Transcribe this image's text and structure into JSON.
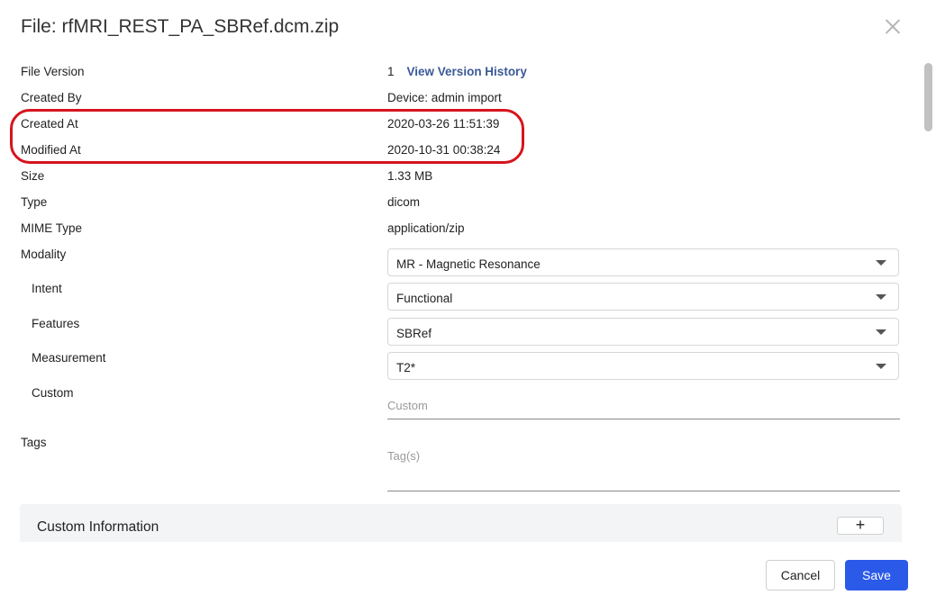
{
  "header": {
    "title": "File: rfMRI_REST_PA_SBRef.dcm.zip",
    "close_icon": "close-icon"
  },
  "fields": {
    "file_version": {
      "label": "File Version",
      "value": "1",
      "link": "View Version History"
    },
    "created_by": {
      "label": "Created By",
      "value": "Device: admin import"
    },
    "created_at": {
      "label": "Created At",
      "value": "2020-03-26 11:51:39"
    },
    "modified_at": {
      "label": "Modified At",
      "value": "2020-10-31 00:38:24"
    },
    "size": {
      "label": "Size",
      "value": "1.33 MB"
    },
    "type": {
      "label": "Type",
      "value": "dicom"
    },
    "mime_type": {
      "label": "MIME Type",
      "value": "application/zip"
    },
    "modality": {
      "label": "Modality",
      "value": "MR - Magnetic Resonance"
    },
    "intent": {
      "label": "Intent",
      "value": "Functional"
    },
    "features": {
      "label": "Features",
      "value": "SBRef"
    },
    "measurement": {
      "label": "Measurement",
      "value": "T2*"
    },
    "custom": {
      "label": "Custom",
      "placeholder": "Custom"
    },
    "tags": {
      "label": "Tags",
      "placeholder": "Tag(s)"
    }
  },
  "custom_information": {
    "title": "Custom Information",
    "add_label": "+"
  },
  "footer": {
    "cancel_label": "Cancel",
    "save_label": "Save"
  },
  "colors": {
    "accent": "#2b5ae8",
    "link": "#3b5998",
    "highlight": "#d6141d"
  }
}
